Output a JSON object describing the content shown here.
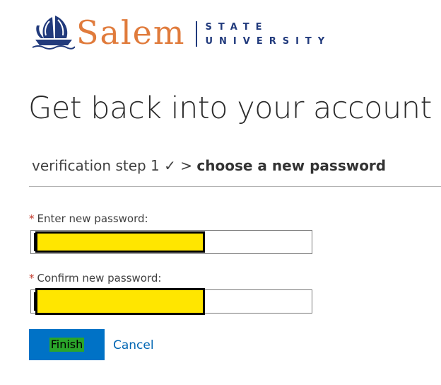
{
  "brand": {
    "name": "Salem",
    "sub_top": "STATE",
    "sub_bottom": "UNIVERSITY",
    "icon": "ship-logo-icon",
    "colors": {
      "wordmark": "#e07b3c",
      "navy": "#213a7c"
    }
  },
  "page": {
    "title": "Get back into your account"
  },
  "breadcrumb": {
    "step_done": "verification step 1",
    "check_glyph": "✓",
    "separator": ">",
    "current": "choose a new password"
  },
  "form": {
    "required_marker": "*",
    "new_password": {
      "label": "Enter new password:",
      "value": "",
      "redacted": true
    },
    "confirm_password": {
      "label": "Confirm new password:",
      "value": "",
      "redacted": true
    }
  },
  "actions": {
    "finish_label": "Finish",
    "cancel_label": "Cancel"
  },
  "colors": {
    "primary_button": "#0072c6",
    "link": "#0066b3",
    "required": "#c0392b",
    "redaction_fill": "#ffe600"
  }
}
